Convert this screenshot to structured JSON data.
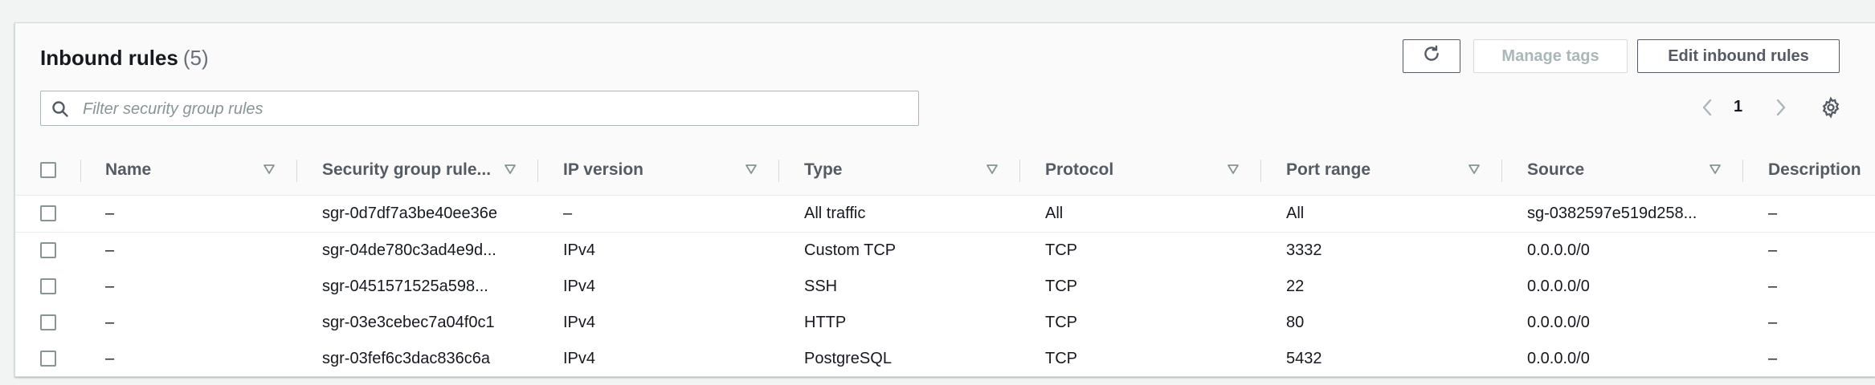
{
  "header": {
    "title": "Inbound rules",
    "count": "(5)",
    "manage_tags_label": "Manage tags",
    "edit_label": "Edit inbound rules"
  },
  "search": {
    "placeholder": "Filter security group rules",
    "value": ""
  },
  "pagination": {
    "current_page": "1"
  },
  "columns": [
    "Name",
    "Security group rule...",
    "IP version",
    "Type",
    "Protocol",
    "Port range",
    "Source",
    "Description"
  ],
  "rows": [
    [
      "–",
      "sgr-0d7df7a3be40ee36e",
      "–",
      "All traffic",
      "All",
      "All",
      "sg-0382597e519d258...",
      "–"
    ],
    [
      "–",
      "sgr-04de780c3ad4e9d...",
      "IPv4",
      "Custom TCP",
      "TCP",
      "3332",
      "0.0.0.0/0",
      "–"
    ],
    [
      "–",
      "sgr-0451571525a598...",
      "IPv4",
      "SSH",
      "TCP",
      "22",
      "0.0.0.0/0",
      "–"
    ],
    [
      "–",
      "sgr-03e3cebec7a04f0c1",
      "IPv4",
      "HTTP",
      "TCP",
      "80",
      "0.0.0.0/0",
      "–"
    ],
    [
      "–",
      "sgr-03fef6c3dac836c6a",
      "IPv4",
      "PostgreSQL",
      "TCP",
      "5432",
      "0.0.0.0/0",
      "–"
    ]
  ],
  "icons": {
    "refresh": "refresh-icon",
    "search": "search-icon",
    "prev": "chevron-left-icon",
    "next": "chevron-right-icon",
    "settings": "gear-icon",
    "sort": "sort-caret-icon"
  }
}
